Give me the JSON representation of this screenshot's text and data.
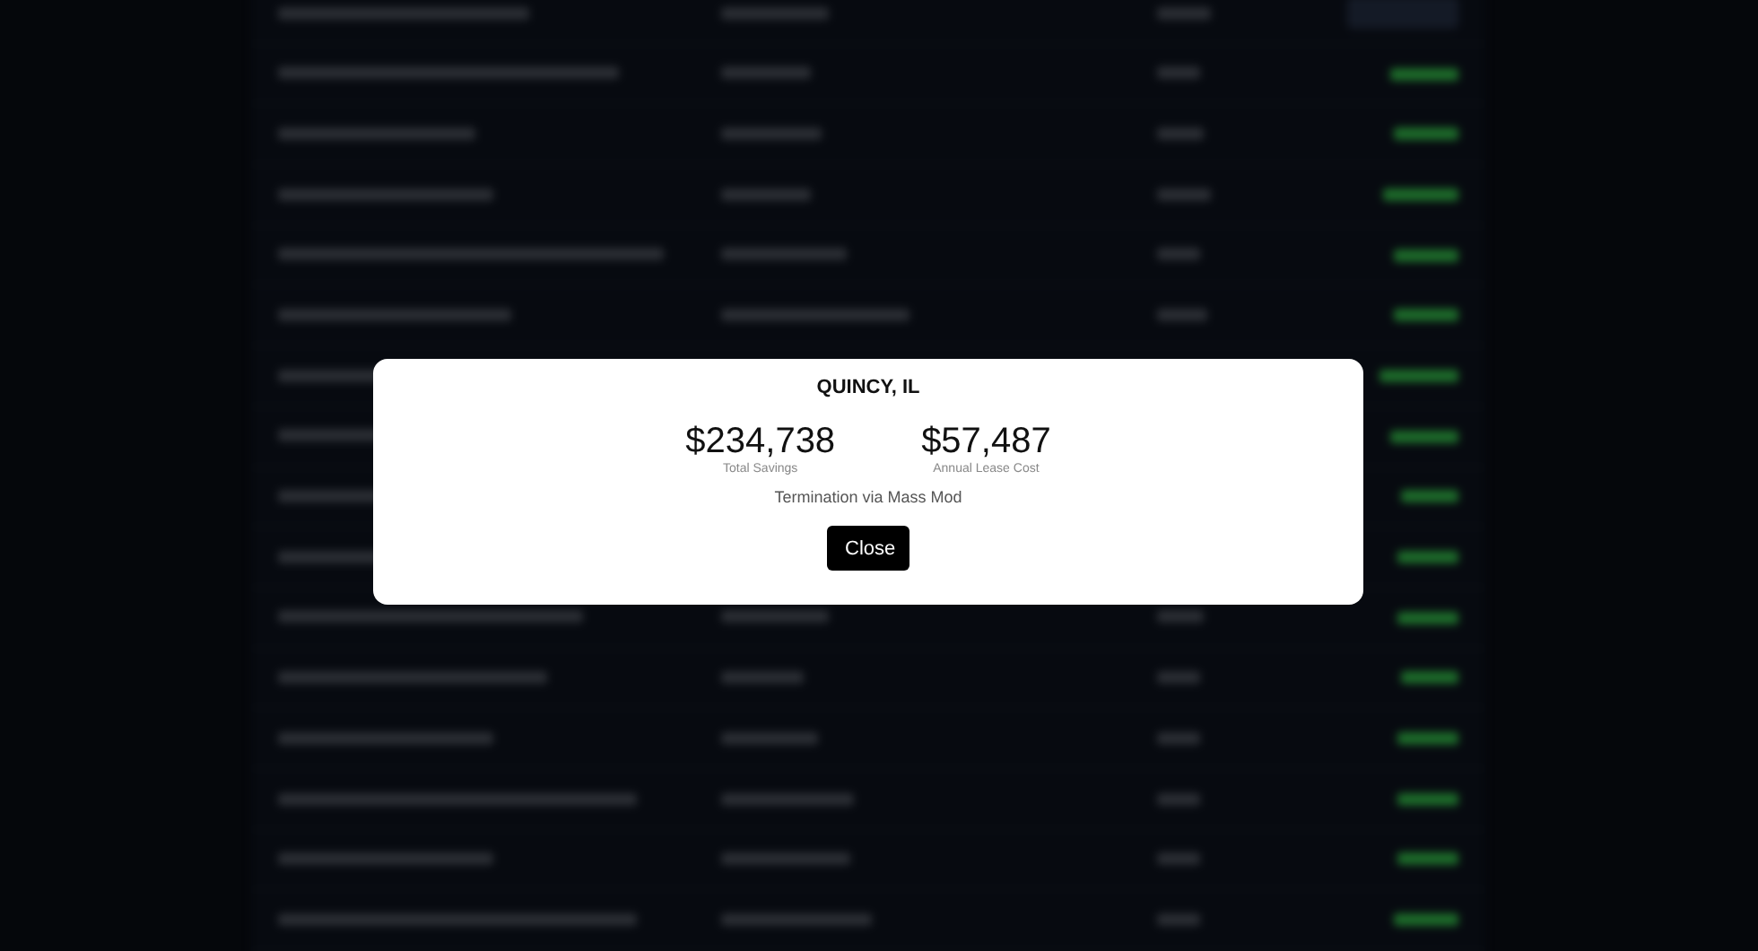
{
  "dialog": {
    "title": "QUINCY, IL",
    "stats": [
      {
        "value": "$234,738",
        "label": "Total Savings"
      },
      {
        "value": "$57,487",
        "label": "Annual Lease Cost"
      }
    ],
    "note": "Termination via Mass Mod",
    "buttons": [
      "Close"
    ]
  }
}
